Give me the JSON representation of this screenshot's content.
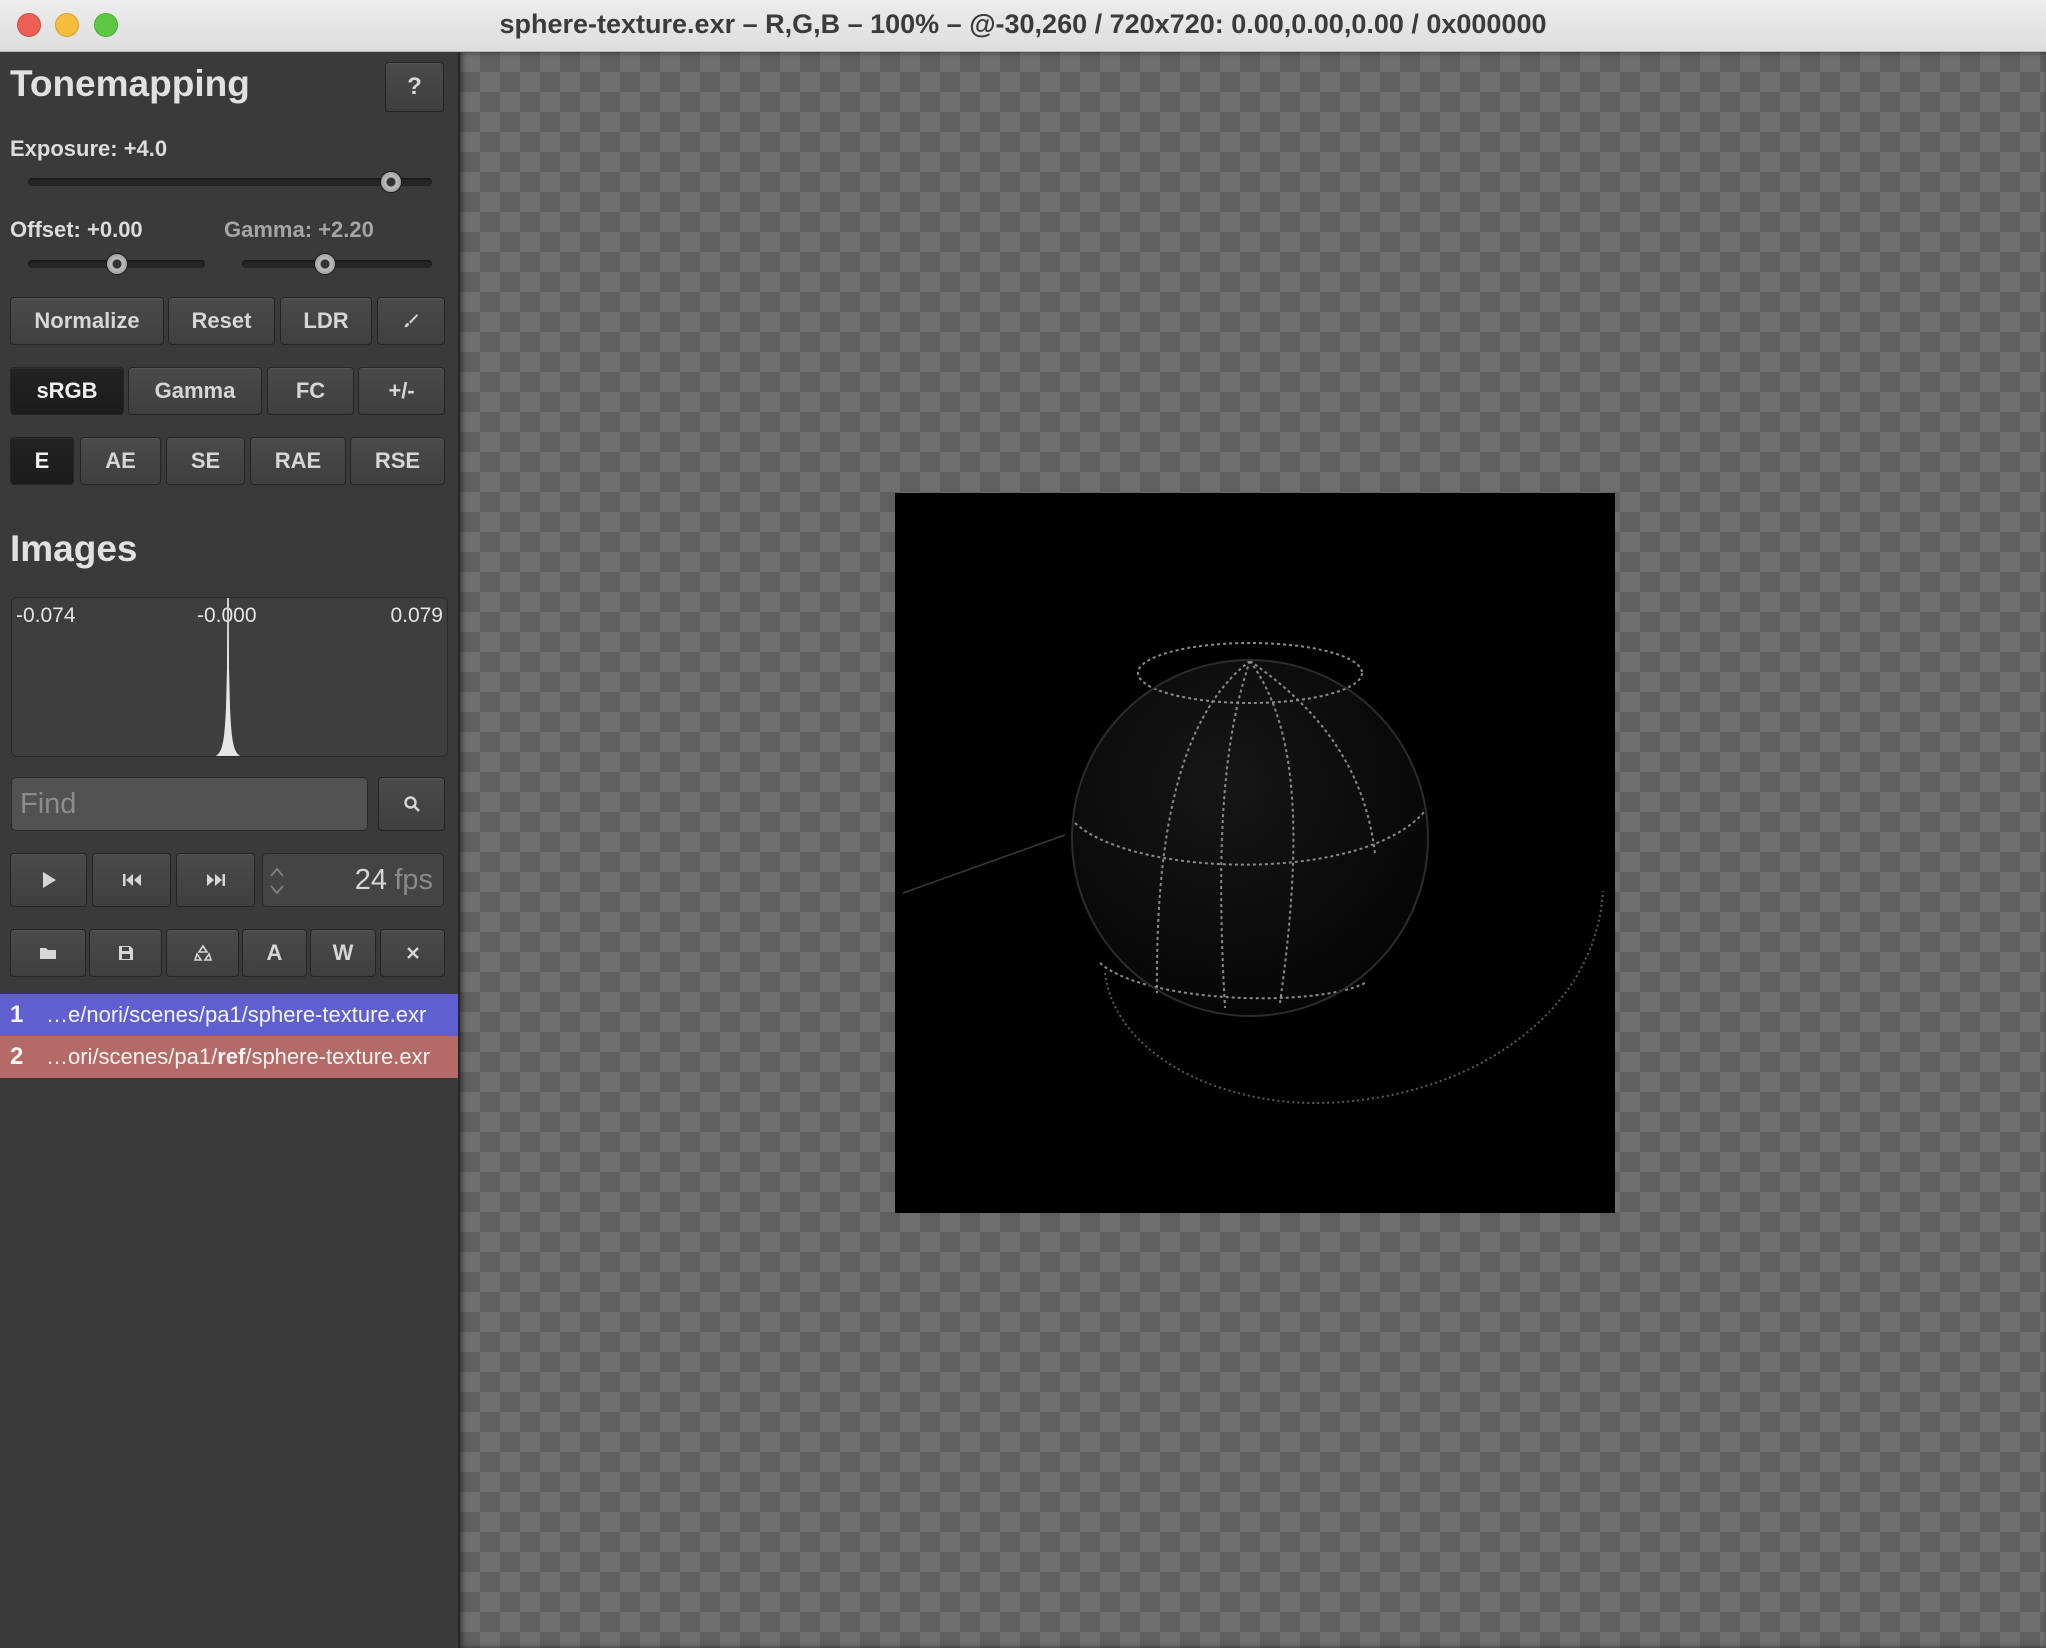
{
  "window": {
    "title": "sphere-texture.exr – R,G,B – 100% – @-30,260 / 720x720: 0.00,0.00,0.00 / 0x000000"
  },
  "tonemapping": {
    "heading": "Tonemapping",
    "help_label": "?",
    "exposure_label": "Exposure: +4.0",
    "exposure_value": 4.0,
    "offset_label": "Offset: +0.00",
    "offset_value": 0.0,
    "gamma_label": "Gamma: +2.20",
    "gamma_value": 2.2,
    "actions": [
      "Normalize",
      "Reset",
      "LDR"
    ],
    "modes": [
      "sRGB",
      "Gamma",
      "FC",
      "+/-"
    ],
    "active_mode": "sRGB",
    "metrics": [
      "E",
      "AE",
      "SE",
      "RAE",
      "RSE"
    ],
    "active_metric": "E"
  },
  "images": {
    "heading": "Images",
    "histogram": {
      "min": "-0.074",
      "mid": "-0.000",
      "max": "0.079"
    },
    "find_placeholder": "Find",
    "fps_value": "24",
    "fps_unit": "fps",
    "file_buttons": [
      "A",
      "W"
    ],
    "list": [
      {
        "num": "1",
        "path_prefix": "…e/nori/scenes/pa1/",
        "path_bold": "",
        "path_suffix": "sphere-texture.exr",
        "color": "#5f5fd0"
      },
      {
        "num": "2",
        "path_prefix": "…ori/scenes/pa1/",
        "path_bold": "ref",
        "path_suffix": "/sphere-texture.exr",
        "color": "#b46a66"
      }
    ]
  },
  "icons": [
    "brush-icon",
    "search-icon",
    "play-icon",
    "skip-back-icon",
    "skip-forward-icon",
    "folder-icon",
    "save-icon",
    "reload-icon",
    "close-icon"
  ]
}
